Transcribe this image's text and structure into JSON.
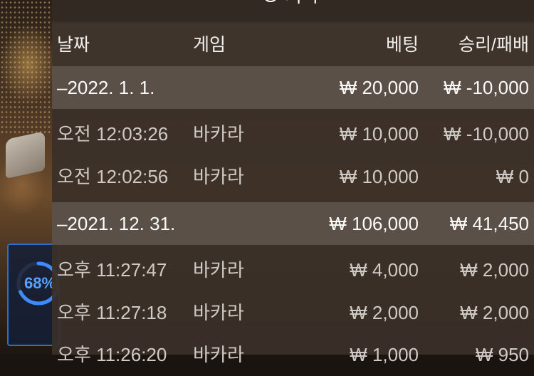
{
  "panel": {
    "title": "기록",
    "clock_icon": "clock-icon"
  },
  "background": {
    "progress_text": "68%",
    "progress_value": 0.68,
    "accent_color": "#2d6fd1"
  },
  "table": {
    "columns": {
      "date": "날짜",
      "game": "게임",
      "bet": "베팅",
      "result": "승리/패배"
    },
    "groups": [
      {
        "date": "–2022. 1. 1.",
        "bet_total": "₩ 20,000",
        "result_total": "₩ -10,000",
        "rows": [
          {
            "time": "오전 12:03:26",
            "game": "바카라",
            "bet": "₩ 10,000",
            "result": "₩ -10,000"
          },
          {
            "time": "오전 12:02:56",
            "game": "바카라",
            "bet": "₩ 10,000",
            "result": "₩ 0"
          }
        ]
      },
      {
        "date": "–2021. 12. 31.",
        "bet_total": "₩ 106,000",
        "result_total": "₩ 41,450",
        "rows": [
          {
            "time": "오후 11:27:47",
            "game": "바카라",
            "bet": "₩ 4,000",
            "result": "₩ 2,000"
          },
          {
            "time": "오후 11:27:18",
            "game": "바카라",
            "bet": "₩ 2,000",
            "result": "₩ 2,000"
          },
          {
            "time": "오후 11:26:20",
            "game": "바카라",
            "bet": "₩ 1,000",
            "result": "₩ 950"
          }
        ]
      }
    ]
  }
}
